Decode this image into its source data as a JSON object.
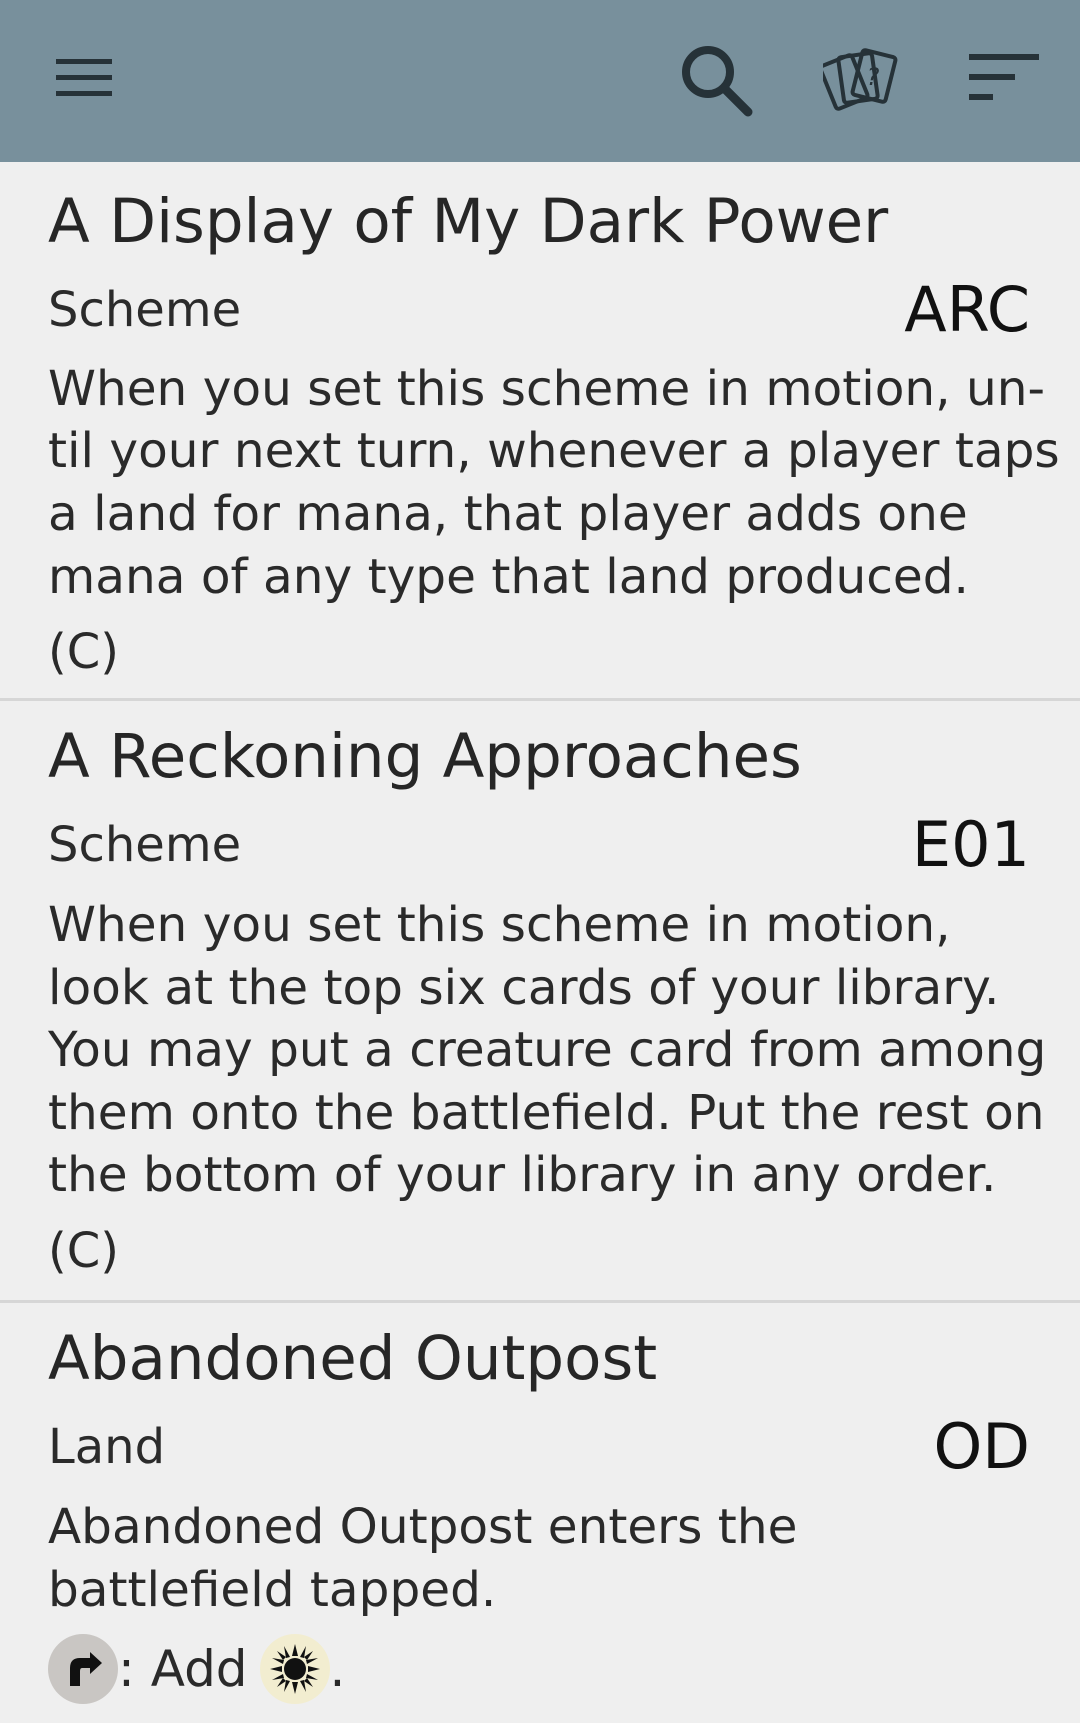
{
  "toolbar": {
    "icons": {
      "menu": "hamburger-menu-icon",
      "search": "search-icon",
      "cards": "cards-question-icon",
      "sort": "sort-icon"
    },
    "background_color": "#78909c"
  },
  "cards": [
    {
      "name": "A Display of My Dark Power",
      "type": "Scheme",
      "set": "ARC",
      "text_lines": [
        "When you set this scheme in motion, un-",
        "til your next turn, whenever a player taps",
        "a land for mana, that player adds one",
        "mana of any type that land produced."
      ],
      "rarity": "(C)"
    },
    {
      "name": "A Reckoning Approaches",
      "type": "Scheme",
      "set": "E01",
      "text_lines": [
        "When you set this scheme in motion,",
        "look at the top six cards of your library.",
        "You may put a creature card from among",
        "them onto the battlefield. Put the rest on",
        "the bottom of your library in any order."
      ],
      "rarity": "(C)"
    },
    {
      "name": "Abandoned Outpost",
      "type": "Land",
      "set": "OD",
      "text_lines": [
        "Abandoned Outpost enters the",
        "battlefield tapped."
      ],
      "mana_line": {
        "tap_symbol": "tap-symbol-icon",
        "text": ": Add",
        "mana_symbol": "white-mana-sun-icon",
        "end": "."
      }
    }
  ]
}
